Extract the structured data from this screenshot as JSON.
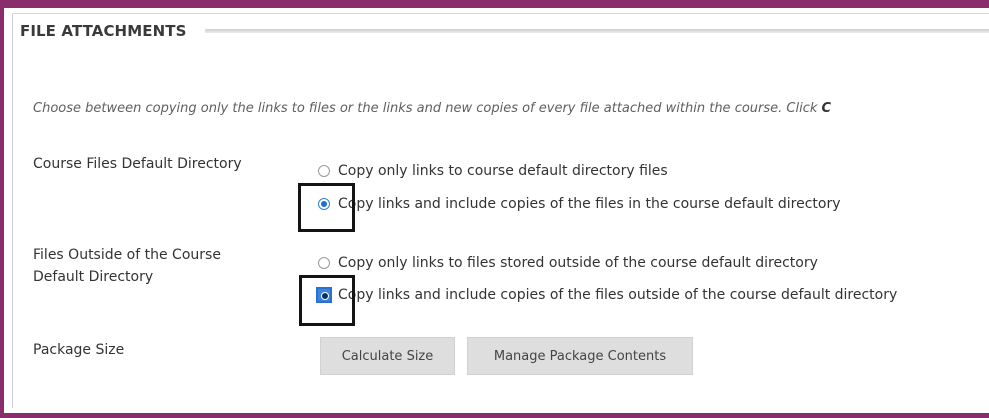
{
  "section": {
    "title": "FILE ATTACHMENTS",
    "instruction_main": "Choose between copying only the links to files or the links and new copies of every file attached within the course. Click",
    "instruction_cut": "C"
  },
  "course_files": {
    "label": "Course Files Default Directory",
    "options": [
      {
        "label": "Copy only links to course default directory files",
        "selected": false
      },
      {
        "label": "Copy links and include copies of the files in the course default directory",
        "selected": true
      }
    ]
  },
  "outside_files": {
    "label_line1": "Files Outside of the Course",
    "label_line2": "Default Directory",
    "options": [
      {
        "label": "Copy only links to files stored outside of the course default directory",
        "selected": false
      },
      {
        "label": "Copy links and include copies of the files outside of the course default directory",
        "selected": true
      }
    ]
  },
  "package": {
    "label": "Package Size",
    "calculate_button": "Calculate Size",
    "manage_button": "Manage Package Contents"
  },
  "colors": {
    "frame": "#8a2d6c",
    "radio_selected": "#1d6fd1",
    "button_bg": "#dedede"
  }
}
